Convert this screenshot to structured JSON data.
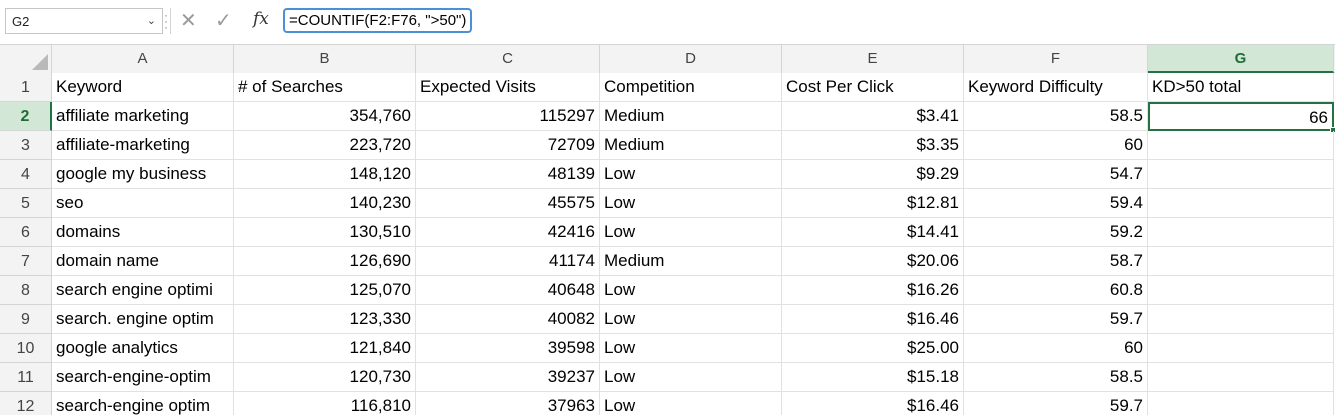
{
  "formula_bar": {
    "name_box": "G2",
    "formula": "=COUNTIF(F2:F76, \">50\")"
  },
  "columns": [
    "A",
    "B",
    "C",
    "D",
    "E",
    "F",
    "G"
  ],
  "selected_column": "G",
  "selected_row": "2",
  "rows": [
    {
      "num": "1",
      "cells": [
        "Keyword",
        "# of Searches",
        "Expected Visits",
        "Competition",
        "Cost Per Click",
        "Keyword Difficulty",
        "KD>50 total"
      ]
    },
    {
      "num": "2",
      "cells": [
        "affiliate marketing",
        "354,760",
        "115297",
        "Medium",
        "$3.41",
        "58.5",
        "66"
      ]
    },
    {
      "num": "3",
      "cells": [
        "affiliate-marketing",
        "223,720",
        "72709",
        "Medium",
        "$3.35",
        "60",
        ""
      ]
    },
    {
      "num": "4",
      "cells": [
        "google my business",
        "148,120",
        "48139",
        "Low",
        "$9.29",
        "54.7",
        ""
      ]
    },
    {
      "num": "5",
      "cells": [
        "seo",
        "140,230",
        "45575",
        "Low",
        "$12.81",
        "59.4",
        ""
      ]
    },
    {
      "num": "6",
      "cells": [
        "domains",
        "130,510",
        "42416",
        "Low",
        "$14.41",
        "59.2",
        ""
      ]
    },
    {
      "num": "7",
      "cells": [
        "domain name",
        "126,690",
        "41174",
        "Medium",
        "$20.06",
        "58.7",
        ""
      ]
    },
    {
      "num": "8",
      "cells": [
        "search engine optimi",
        "125,070",
        "40648",
        "Low",
        "$16.26",
        "60.8",
        ""
      ]
    },
    {
      "num": "9",
      "cells": [
        "search. engine optim",
        "123,330",
        "40082",
        "Low",
        "$16.46",
        "59.7",
        ""
      ]
    },
    {
      "num": "10",
      "cells": [
        "google analytics",
        "121,840",
        "39598",
        "Low",
        "$25.00",
        "60",
        ""
      ]
    },
    {
      "num": "11",
      "cells": [
        "search-engine-optim",
        "120,730",
        "39237",
        "Low",
        "$15.18",
        "58.5",
        ""
      ]
    },
    {
      "num": "12",
      "cells": [
        "search-engine optim",
        "116,810",
        "37963",
        "Low",
        "$16.46",
        "59.7",
        ""
      ]
    }
  ]
}
